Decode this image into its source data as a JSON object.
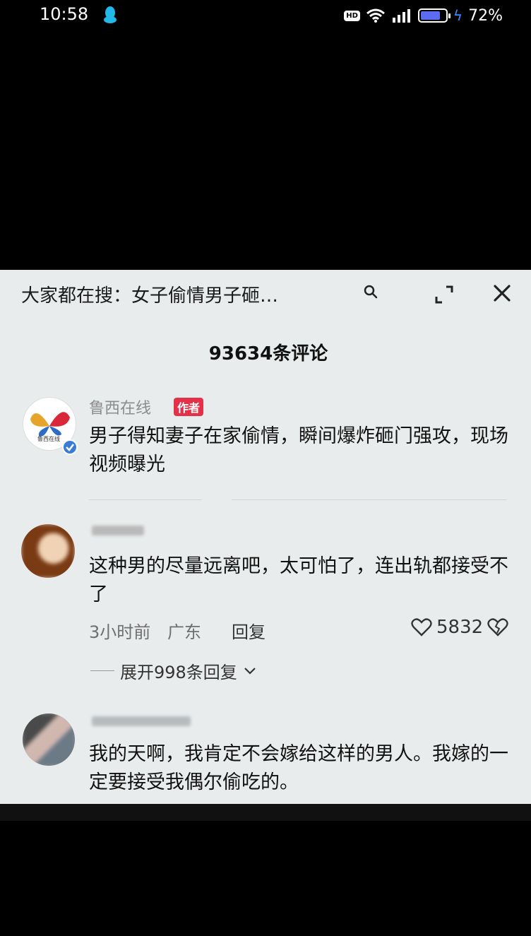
{
  "status_bar": {
    "time": "10:58",
    "hd_badge": "HD",
    "battery_percent": "72%",
    "battery_level": 0.72,
    "icons": [
      "qq-icon",
      "wifi-icon",
      "signal-icon",
      "battery-icon",
      "charging-icon"
    ]
  },
  "header": {
    "search_hint": "大家都在搜：女子偷情男子砸…",
    "icons": [
      "search-icon",
      "expand-icon",
      "close-icon"
    ]
  },
  "comment_count": "93634条评论",
  "comments": [
    {
      "name": "鲁西在线",
      "badge": "作者",
      "avatar_text": "鲁西在线",
      "text": "男子得知妻子在家偷情，瞬间爆炸砸门强攻，现场视频曝光"
    },
    {
      "text": "这种男的尽量远离吧，太可怕了，连出轨都接受不了",
      "time": "3小时前",
      "location": "广东",
      "reply_label": "回复",
      "likes": "5832",
      "expand_replies": "展开998条回复"
    },
    {
      "text": "我的天啊，我肯定不会嫁给这样的男人。我嫁的一定要接受我偶尔偷吃的。"
    }
  ],
  "colors": {
    "sheet_bg": "#e9ecec",
    "author_badge": "#e3314a",
    "verified": "#3a7bd5",
    "battery_fill": "#5b6cf0"
  }
}
